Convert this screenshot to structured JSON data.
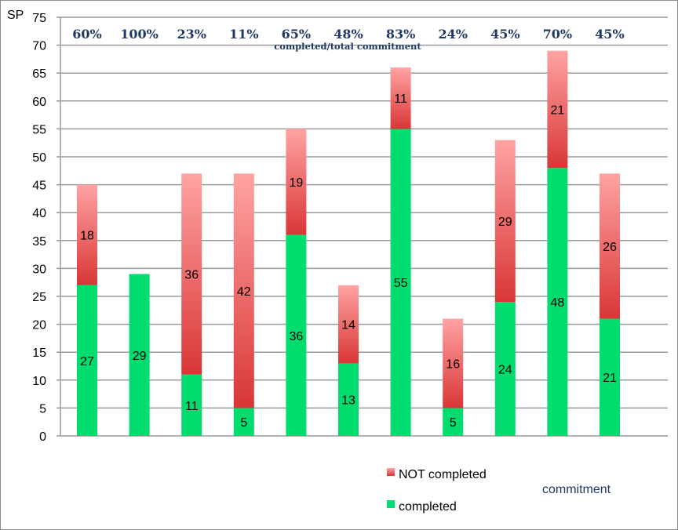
{
  "chart_data": {
    "type": "bar",
    "stacked": true,
    "ylabel": "SP",
    "ylim": [
      0,
      75
    ],
    "ytick_step": 5,
    "grid": true,
    "legend_placement": "bottom",
    "series": [
      {
        "name": "completed",
        "color": "#00dd6e",
        "values": [
          27,
          29,
          11,
          5,
          36,
          13,
          55,
          5,
          24,
          48,
          21
        ]
      },
      {
        "name": "NOT completed",
        "color": "#e05a5a",
        "values": [
          18,
          0,
          36,
          42,
          19,
          14,
          11,
          16,
          29,
          21,
          26
        ]
      }
    ],
    "percent_labels": [
      "60%",
      "100%",
      "23%",
      "11%",
      "65%",
      "48%",
      "83%",
      "24%",
      "45%",
      "70%",
      "45%"
    ],
    "percent_caption": "completed/total commitment",
    "annotation": "commitment"
  }
}
